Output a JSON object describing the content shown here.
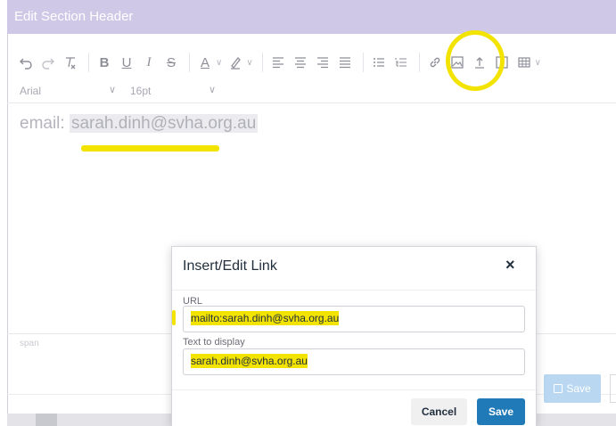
{
  "window": {
    "title": "Edit Section Header"
  },
  "toolbar": {
    "buttons": [
      {
        "name": "undo-icon",
        "glyph": "↶"
      },
      {
        "name": "redo-icon",
        "glyph": "↷"
      },
      {
        "name": "clear-formatting-icon",
        "glyph": "T̲"
      },
      {
        "name": "bold-icon",
        "glyph": "B"
      },
      {
        "name": "underline-icon",
        "glyph": "U"
      },
      {
        "name": "italic-icon",
        "glyph": "I"
      },
      {
        "name": "strikethrough-icon",
        "glyph": "S"
      },
      {
        "name": "text-color-icon",
        "glyph": "A"
      },
      {
        "name": "highlight-color-icon",
        "glyph": "✎"
      },
      {
        "name": "align-left-icon",
        "glyph": "≡"
      },
      {
        "name": "align-center-icon",
        "glyph": "≡"
      },
      {
        "name": "align-right-icon",
        "glyph": "≡"
      },
      {
        "name": "align-justify-icon",
        "glyph": "≡"
      },
      {
        "name": "bullet-list-icon",
        "glyph": "☰"
      },
      {
        "name": "numbered-list-icon",
        "glyph": "☰"
      },
      {
        "name": "link-icon",
        "glyph": "🔗"
      },
      {
        "name": "image-icon",
        "glyph": "▣"
      },
      {
        "name": "upload-icon",
        "glyph": "⇧"
      },
      {
        "name": "media-icon",
        "glyph": "▶"
      },
      {
        "name": "table-icon",
        "glyph": "▦"
      }
    ]
  },
  "fontbar": {
    "font": "Arial",
    "size": "16pt"
  },
  "editor": {
    "label": "email:",
    "email": "sarah.dinh@svha.org.au"
  },
  "statusbar": {
    "path": "span"
  },
  "page": {
    "save_label": "Save"
  },
  "dialog": {
    "title": "Insert/Edit Link",
    "close_glyph": "×",
    "url_label": "URL",
    "url_value": "mailto:sarah.dinh@svha.org.au",
    "text_label": "Text to display",
    "text_value": "sarah.dinh@svha.org.au",
    "cancel_label": "Cancel",
    "save_label": "Save"
  },
  "colors": {
    "titlebar": "#cfc8e6",
    "highlight": "#f3e300",
    "primary_button": "#207ab7",
    "disabled_save": "#b9d7f0"
  }
}
